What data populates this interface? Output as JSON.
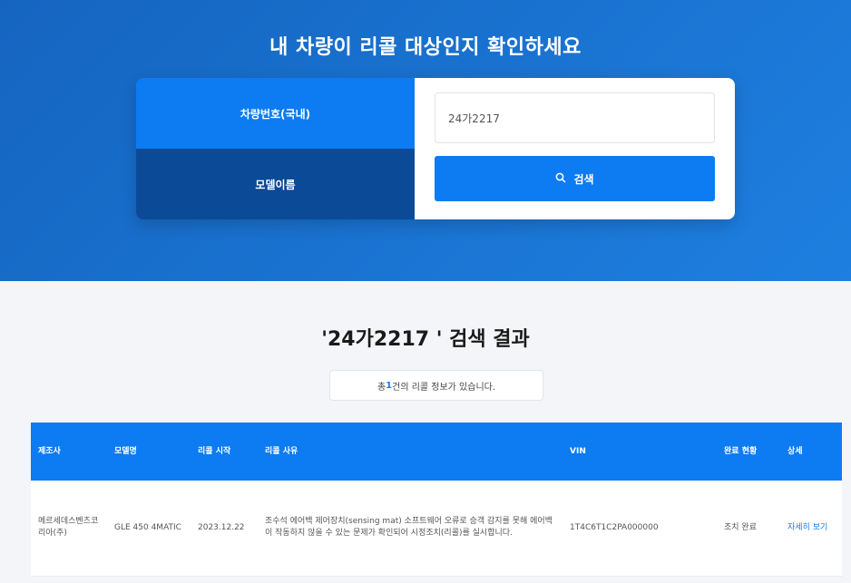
{
  "hero": {
    "title": "내 차량이 리콜 대상인지 확인하세요"
  },
  "search": {
    "tabs": [
      {
        "label": "차량번호(국내)",
        "active": true
      },
      {
        "label": "모델이름",
        "active": false
      }
    ],
    "input_value": "24가2217",
    "button_label": "검색",
    "button_icon": "search-icon"
  },
  "results": {
    "title": "'24가2217 ' 검색 결과",
    "count_prefix": "총 ",
    "count_number": "1",
    "count_suffix": "건의 리콜 정보가 있습니다.",
    "columns": [
      "제조사",
      "모델명",
      "리콜 시작",
      "리콜 사유",
      "VIN",
      "완료 현황",
      "상세"
    ],
    "rows": [
      {
        "maker": "메르세데스벤츠코리아(주)",
        "model": "GLE 450 4MATIC",
        "start": "2023.12.22",
        "reason": "조수석 에어백 제어장치(sensing mat) 소프트웨어 오류로 승객 감지를 못해 에어백이 작동하지 않을 수 있는 문제가 확인되어 시정조치(리콜)를 실시합니다.",
        "vin": "1T4C6T1C2PA000000",
        "status": "조치 완료",
        "detail": "자세히 보기"
      }
    ]
  },
  "colors": {
    "hero_gradient_start": "#1565c0",
    "hero_gradient_end": "#1e7fe0",
    "accent": "#0d7bf2",
    "tab_inactive": "#0b4a96"
  }
}
